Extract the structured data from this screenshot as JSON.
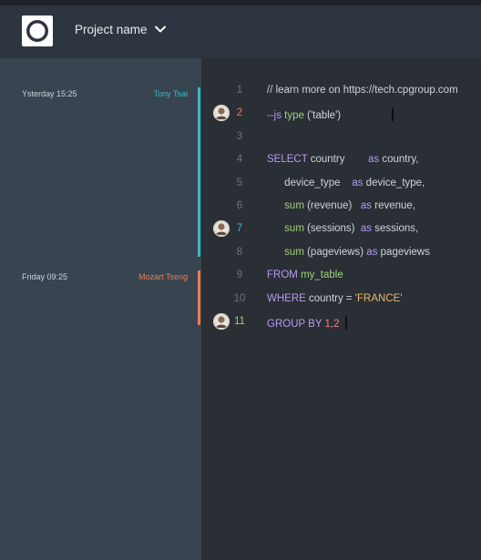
{
  "header": {
    "project_name": "Project name",
    "logo_icon": "ring-logo-icon",
    "dropdown_icon": "chevron-down-icon"
  },
  "history": [
    {
      "time": "Ysterday 15:25",
      "author": "Tony Tsai",
      "color": "#3fb6c8"
    },
    {
      "time": "Friday 09:25",
      "author": "Mozart Tseng",
      "color": "#ee7a5a"
    }
  ],
  "editor": {
    "lines": [
      {
        "n": "1",
        "tokens": [
          {
            "t": "// learn more on https://tech.cpgroup.com",
            "c": "cm"
          }
        ]
      },
      {
        "n": "2",
        "tokens": [
          {
            "t": "--js ",
            "c": "kw"
          },
          {
            "t": "type",
            "c": "fn"
          },
          {
            "t": " ('table')",
            "c": "pl"
          }
        ]
      },
      {
        "n": "3",
        "tokens": []
      },
      {
        "n": "4",
        "tokens": [
          {
            "t": "SELECT",
            "c": "kw"
          },
          {
            "t": " country        ",
            "c": "pl"
          },
          {
            "t": "as",
            "c": "kw"
          },
          {
            "t": " country,",
            "c": "pl"
          }
        ]
      },
      {
        "n": "5",
        "tokens": [
          {
            "t": "      device_type    ",
            "c": "pl"
          },
          {
            "t": "as",
            "c": "kw"
          },
          {
            "t": " device_type,",
            "c": "pl"
          }
        ]
      },
      {
        "n": "6",
        "tokens": [
          {
            "t": "      ",
            "c": "pl"
          },
          {
            "t": "sum",
            "c": "fn"
          },
          {
            "t": " (revenue)   ",
            "c": "pl"
          },
          {
            "t": "as",
            "c": "kw"
          },
          {
            "t": " revenue,",
            "c": "pl"
          }
        ]
      },
      {
        "n": "7",
        "tokens": [
          {
            "t": "      ",
            "c": "pl"
          },
          {
            "t": "sum",
            "c": "fn"
          },
          {
            "t": " (sessions)  ",
            "c": "pl"
          },
          {
            "t": "as",
            "c": "kw"
          },
          {
            "t": " sessions,",
            "c": "pl"
          }
        ]
      },
      {
        "n": "8",
        "tokens": [
          {
            "t": "      ",
            "c": "pl"
          },
          {
            "t": "sum",
            "c": "fn"
          },
          {
            "t": " (pageviews) ",
            "c": "pl"
          },
          {
            "t": "as",
            "c": "kw"
          },
          {
            "t": " pageviews",
            "c": "pl"
          }
        ]
      },
      {
        "n": "9",
        "tokens": [
          {
            "t": "FROM ",
            "c": "kw"
          },
          {
            "t": "my_table",
            "c": "fn"
          }
        ]
      },
      {
        "n": "10",
        "tokens": [
          {
            "t": "WHERE",
            "c": "kw"
          },
          {
            "t": " country = ",
            "c": "pl"
          },
          {
            "t": "'FRANCE'",
            "c": "str"
          }
        ]
      },
      {
        "n": "11",
        "tokens": [
          {
            "t": "GROUP BY ",
            "c": "kw"
          },
          {
            "t": "1,2",
            "c": "num"
          }
        ]
      }
    ],
    "collaborators": [
      {
        "line": "2",
        "icon": "collaborator-avatar-icon",
        "line_color": "#ee7a5a"
      },
      {
        "line": "7",
        "icon": "collaborator-avatar-icon",
        "line_color": "#3fb6c8"
      },
      {
        "line": "11",
        "icon": "collaborator-avatar-icon",
        "line_color": "#9fd17a"
      }
    ]
  }
}
